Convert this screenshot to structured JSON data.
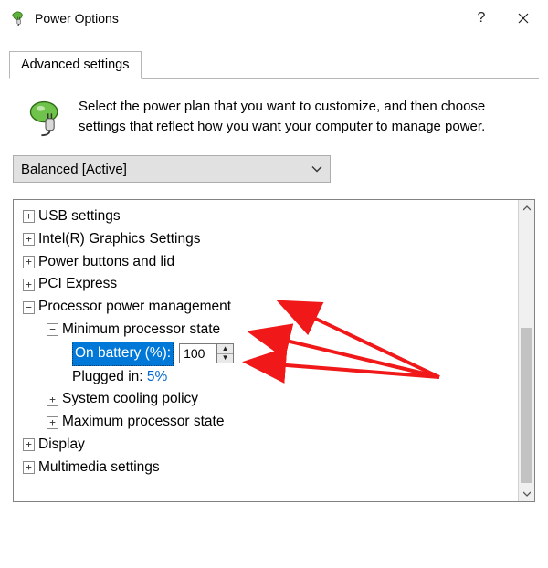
{
  "window": {
    "title": "Power Options"
  },
  "tab": {
    "label": "Advanced settings"
  },
  "intro": {
    "text": "Select the power plan that you want to customize, and then choose settings that reflect how you want your computer to manage power."
  },
  "plan": {
    "selected": "Balanced [Active]"
  },
  "tree": {
    "usb": "USB settings",
    "intel_graphics": "Intel(R) Graphics Settings",
    "power_buttons": "Power buttons and lid",
    "pci": "PCI Express",
    "proc_mgmt": "Processor power management",
    "min_proc": "Minimum processor state",
    "on_battery_label": "On battery (%):",
    "on_battery_value": "100",
    "plugged_label": "Plugged in:",
    "plugged_value": "5%",
    "cooling": "System cooling policy",
    "max_proc": "Maximum processor state",
    "display": "Display",
    "multimedia": "Multimedia settings"
  }
}
